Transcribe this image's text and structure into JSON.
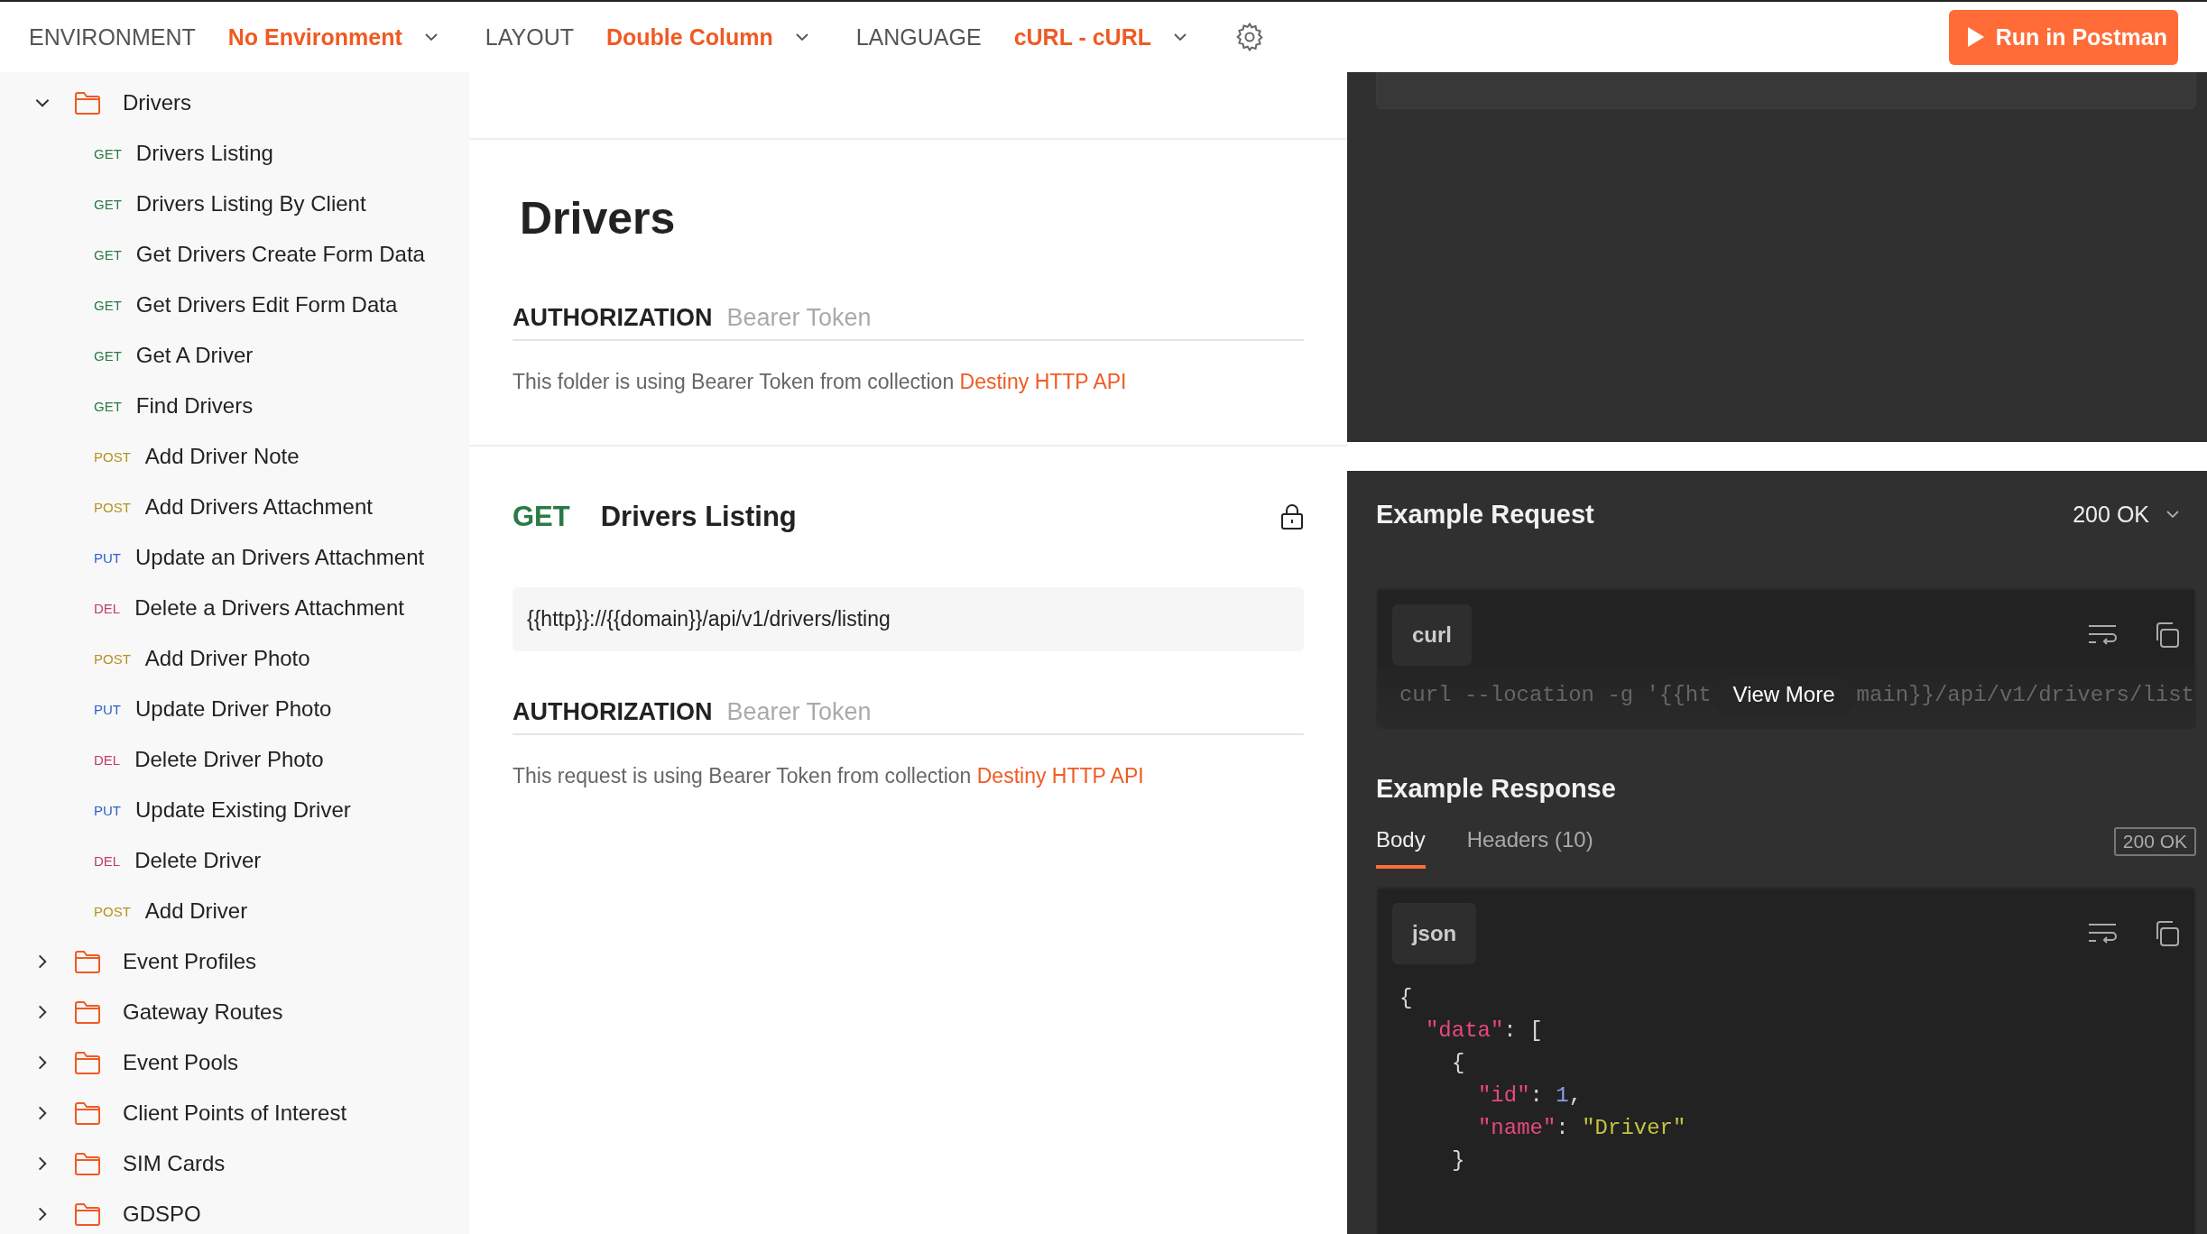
{
  "top_bar": {
    "settings": [
      {
        "label": "ENVIRONMENT",
        "value": "No Environment"
      },
      {
        "label": "LAYOUT",
        "value": "Double Column"
      },
      {
        "label": "LANGUAGE",
        "value": "cURL - cURL"
      }
    ],
    "run_button": "Run in Postman"
  },
  "sidebar": {
    "items": [
      {
        "name": "Drivers",
        "expanded": true,
        "children": [
          {
            "method": "GET",
            "name": "Drivers Listing"
          },
          {
            "method": "GET",
            "name": "Drivers Listing By Client"
          },
          {
            "method": "GET",
            "name": "Get Drivers Create Form Data"
          },
          {
            "method": "GET",
            "name": "Get Drivers Edit Form Data"
          },
          {
            "method": "GET",
            "name": "Get A Driver"
          },
          {
            "method": "GET",
            "name": "Find Drivers"
          },
          {
            "method": "POST",
            "name": "Add Driver Note"
          },
          {
            "method": "POST",
            "name": "Add Drivers Attachment"
          },
          {
            "method": "PUT",
            "name": "Update an Drivers Attachment"
          },
          {
            "method": "DEL",
            "name": "Delete a Drivers Attachment"
          },
          {
            "method": "POST",
            "name": "Add Driver Photo"
          },
          {
            "method": "PUT",
            "name": "Update Driver Photo"
          },
          {
            "method": "DEL",
            "name": "Delete Driver Photo"
          },
          {
            "method": "PUT",
            "name": "Update Existing Driver"
          },
          {
            "method": "DEL",
            "name": "Delete Driver"
          },
          {
            "method": "POST",
            "name": "Add Driver"
          }
        ]
      },
      {
        "name": "Event Profiles",
        "expanded": false
      },
      {
        "name": "Gateway Routes",
        "expanded": false
      },
      {
        "name": "Event Pools",
        "expanded": false
      },
      {
        "name": "Client Points of Interest",
        "expanded": false
      },
      {
        "name": "SIM Cards",
        "expanded": false
      },
      {
        "name": "GDSPO",
        "expanded": false
      }
    ]
  },
  "folder": {
    "title": "Drivers",
    "auth_label": "AUTHORIZATION",
    "auth_type": "Bearer Token",
    "note": "This folder is using Bearer Token from collection",
    "link": "Destiny HTTP API"
  },
  "request": {
    "method": "GET",
    "name": "Drivers Listing",
    "url": "{{http}}://{{domain}}/api/v1/drivers/listing",
    "auth_label": "AUTHORIZATION",
    "auth_type": "Bearer Token",
    "note": "This request is using Bearer Token from collection",
    "link": "Destiny HTTP API"
  },
  "example_request": {
    "title": "Example Request",
    "status": "200 OK",
    "language": "curl",
    "code_before": "curl --location -g '{{ht",
    "view_more": "View More",
    "code_after": "main}}/api/v1/drivers/list"
  },
  "example_response": {
    "title": "Example Response",
    "tabs": [
      {
        "label": "Body",
        "selected": true
      },
      {
        "label": "Headers (10)",
        "selected": false
      }
    ],
    "status": "200 OK",
    "language": "json",
    "lines": [
      {
        "tokens": [
          {
            "kind": "punct",
            "text": "{"
          }
        ],
        "children": [
          {
            "tokens": [
              {
                "kind": "key",
                "text": "\"data\""
              },
              {
                "kind": "punct",
                "text": ": ["
              }
            ],
            "children": [
              {
                "tokens": [
                  {
                    "kind": "punct",
                    "text": "{"
                  }
                ],
                "children": [
                  {
                    "tokens": [
                      {
                        "kind": "key",
                        "text": "\"id\""
                      },
                      {
                        "kind": "punct",
                        "text": ": "
                      },
                      {
                        "kind": "number",
                        "text": "1"
                      },
                      {
                        "kind": "punct",
                        "text": ","
                      }
                    ]
                  },
                  {
                    "tokens": [
                      {
                        "kind": "key",
                        "text": "\"name\""
                      },
                      {
                        "kind": "punct",
                        "text": ": "
                      },
                      {
                        "kind": "string",
                        "text": "\"Driver\""
                      }
                    ]
                  }
                ]
              },
              {
                "tokens": [
                  {
                    "kind": "punct",
                    "text": "}"
                  }
                ]
              }
            ]
          }
        ]
      }
    ]
  }
}
